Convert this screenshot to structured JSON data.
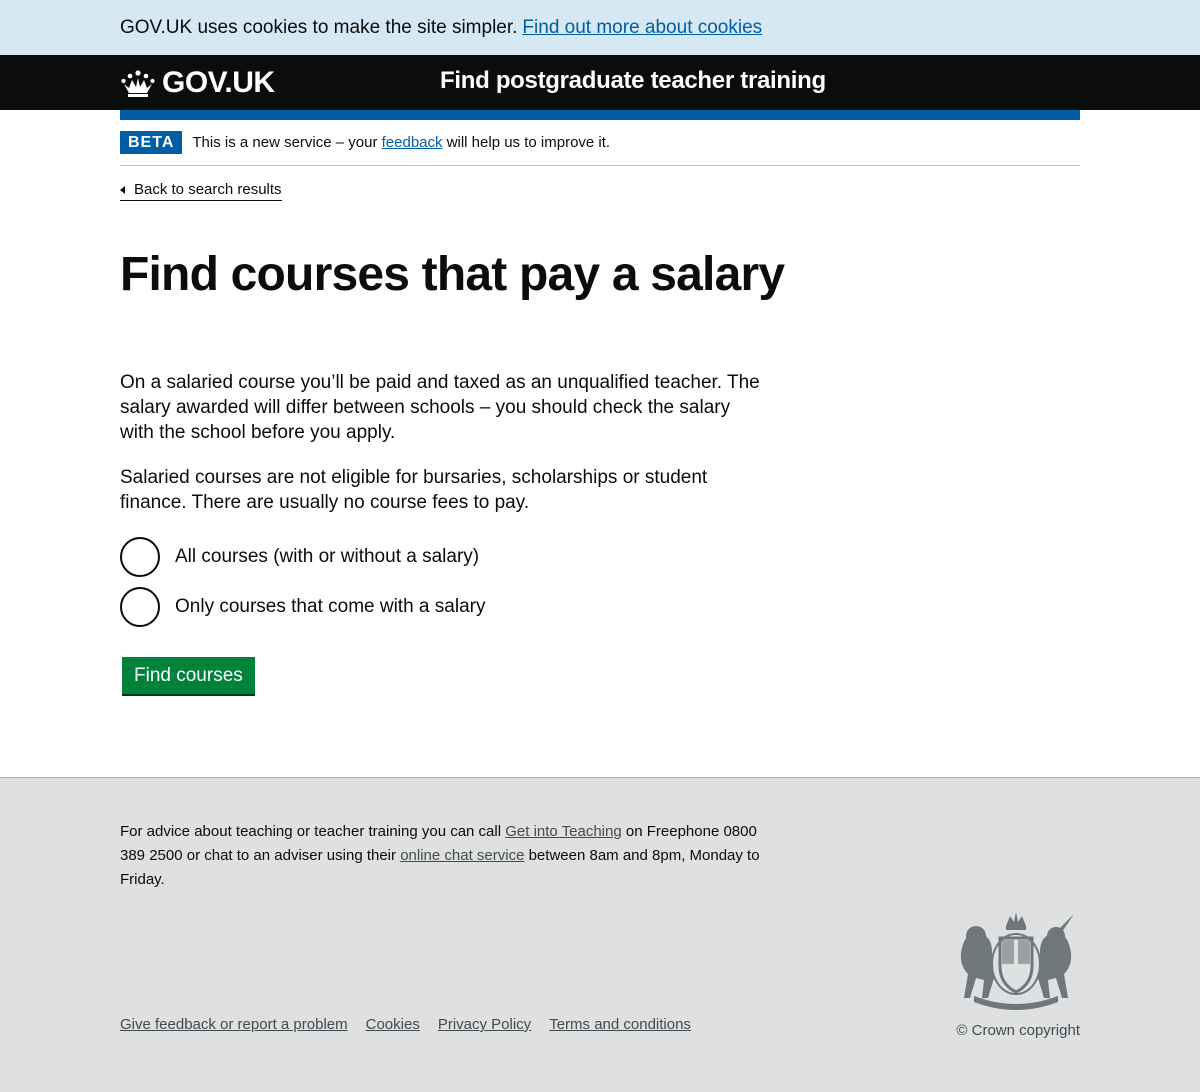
{
  "cookie_banner": {
    "text": "GOV.UK uses cookies to make the site simpler.",
    "link": "Find out more about cookies"
  },
  "header": {
    "logo_text": "GOV.UK",
    "service_name": "Find postgraduate teacher training",
    "logo_icon": "crown-icon"
  },
  "phase_banner": {
    "tag": "BETA",
    "text_before": "This is a new service – your",
    "link": "feedback",
    "text_after": "will help us to improve it."
  },
  "back_link": "Back to search results",
  "page_title": "Find courses that pay a salary",
  "body": {
    "paragraph_1": "On a salaried course you’ll be paid and taxed as an unqualified teacher. The salary awarded will differ between schools – you should check the salary with the school before you apply.",
    "paragraph_2": "Salaried courses are not eligible for bursaries, scholarships or student finance. There are usually no course fees to pay."
  },
  "options": [
    {
      "label": "All courses (with or without a salary)"
    },
    {
      "label": "Only courses that come with a salary"
    }
  ],
  "submit_label": "Find courses",
  "footer": {
    "advice_1": "For advice about teaching or teacher training you can call",
    "link_get_into_teaching": "Get into Teaching",
    "advice_2": "on Freephone 0800 389 2500 or chat to an adviser using their",
    "link_online_chat": "online chat service",
    "advice_3": "between 8am and 8pm, Monday to Friday.",
    "links": [
      "Give feedback or report a problem",
      "Cookies",
      "Privacy Policy",
      "Terms and conditions"
    ],
    "copyright": "© Crown copyright"
  },
  "colors": {
    "brand_blue": "#005ea5",
    "button_green": "#00823b",
    "header_black": "#0b0c0c",
    "footer_grey": "#dee0e2",
    "cookie_banner_blue": "#d5e8f3"
  }
}
